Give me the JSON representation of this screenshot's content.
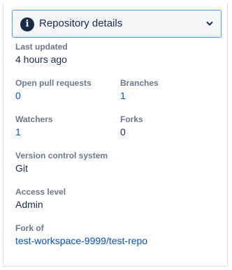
{
  "header": {
    "title": "Repository details",
    "info_icon_glyph": "i",
    "icon": "info-icon",
    "toggle_icon": "chevron-down-icon"
  },
  "details": {
    "last_updated": {
      "label": "Last updated",
      "value": "4 hours ago"
    },
    "open_pull_requests": {
      "label": "Open pull requests",
      "value": "0"
    },
    "branches": {
      "label": "Branches",
      "value": "1"
    },
    "watchers": {
      "label": "Watchers",
      "value": "1"
    },
    "forks": {
      "label": "Forks",
      "value": "0"
    },
    "version_control": {
      "label": "Version control system",
      "value": "Git"
    },
    "access_level": {
      "label": "Access level",
      "value": "Admin"
    },
    "fork_of": {
      "label": "Fork of",
      "value": "test-workspace-9999/test-repo"
    }
  },
  "colors": {
    "link": "#0052cc",
    "label": "#6b778c",
    "text": "#172b4d",
    "header_border": "#4c9aff",
    "header_bg": "#f4f5f7"
  }
}
